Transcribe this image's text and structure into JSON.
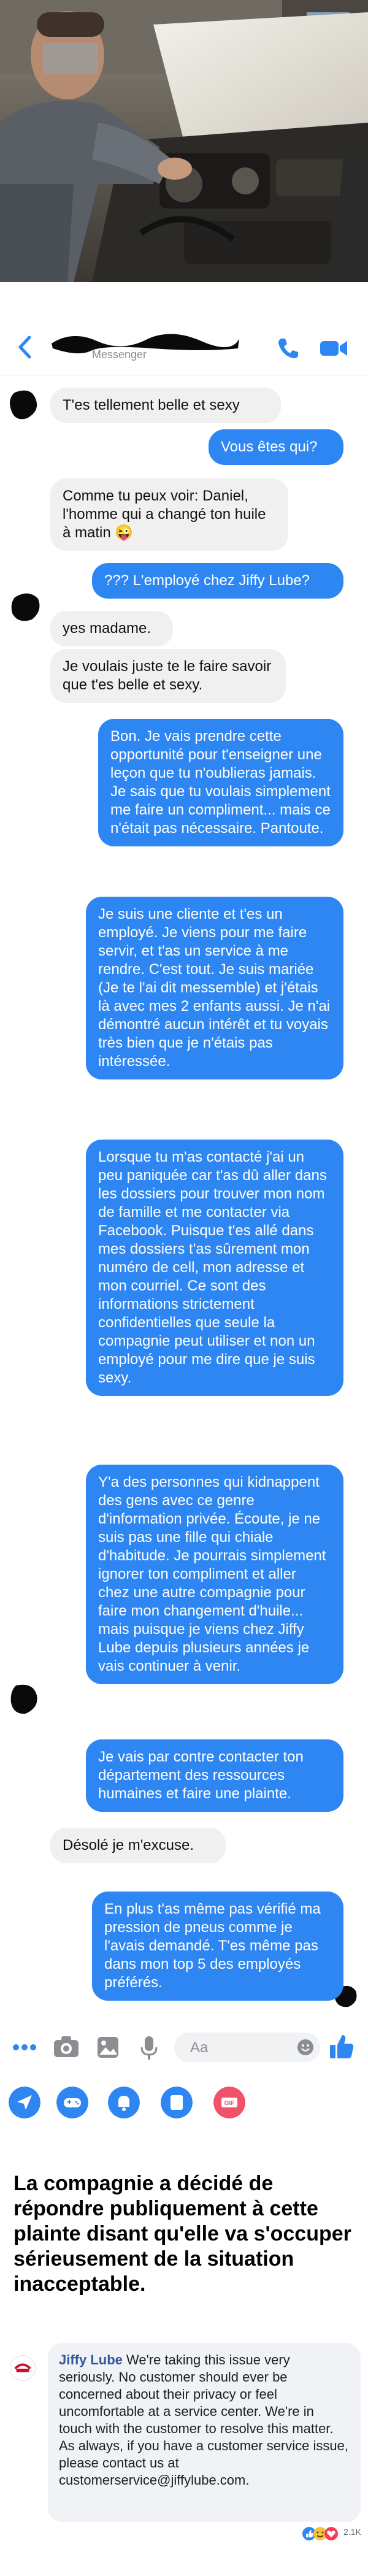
{
  "header": {
    "subtitle": "Messenger"
  },
  "messages": [
    {
      "from": "in",
      "text": "T'es tellement belle et sexy"
    },
    {
      "from": "out",
      "text": "Vous êtes qui?"
    },
    {
      "from": "in",
      "text": "Comme tu peux voir: Daniel, l'homme qui a changé ton huile à matin 😜"
    },
    {
      "from": "out",
      "text": "??? L'employé chez Jiffy Lube?"
    },
    {
      "from": "in",
      "text": "yes madame."
    },
    {
      "from": "in",
      "text": "Je voulais juste te le faire savoir que t'es belle et sexy."
    },
    {
      "from": "out",
      "text": "Bon. Je vais prendre cette opportunité pour t'enseigner une leçon que tu n'oublieras jamais. Je sais que tu voulais simplement me faire un compliment... mais ce n'était pas nécessaire. Pantoute."
    },
    {
      "from": "out",
      "text": "Je suis une cliente et t'es un employé. Je viens pour me faire servir, et t'as un service à me rendre. C'est tout. Je suis mariée (Je te l'ai dit messemble) et j'étais là avec mes 2 enfants aussi. Je n'ai démontré aucun intérêt et tu voyais très bien que je n'étais pas intéressée."
    },
    {
      "from": "out",
      "text": "Lorsque tu m'as contacté j'ai un peu paniquée car t'as dû aller dans les dossiers pour trouver mon nom de famille et me contacter via Facebook. Puisque t'es allé dans mes dossiers t'as sûrement mon numéro de cell, mon adresse et mon courriel. Ce sont des informations strictement confidentielles que seule la compagnie peut utiliser et non un employé pour me dire que je suis sexy."
    },
    {
      "from": "out",
      "text": "Y'a des personnes qui kidnappent des gens avec ce genre d'information privée. Écoute, je ne suis pas une fille qui chiale d'habitude. Je pourrais simplement ignorer ton compliment et aller chez une autre compagnie pour faire mon changement d'huile... mais puisque je viens chez Jiffy Lube depuis plusieurs années je vais continuer à venir."
    },
    {
      "from": "out",
      "text": "Je vais par contre contacter ton département des ressources humaines et faire une plainte."
    },
    {
      "from": "in",
      "text": "Désolé je m'excuse."
    },
    {
      "from": "out",
      "text": "En plus t'as même pas vérifié ma pression de pneus comme je l'avais demandé. T'es même pas dans mon top 5 des employés préférés."
    }
  ],
  "composer": {
    "placeholder": "Aa"
  },
  "caption": "La compagnie a décidé de répondre publiquement à cette plainte disant qu'elle va s'occuper sérieusement de la situation inacceptable.",
  "comment": {
    "author": "Jiffy Lube",
    "text": "We're taking this issue very seriously. No customer should ever be concerned about their privacy or feel uncomfortable at a service center. We're in touch with the customer to resolve this matter. As always, if you have a customer service issue, please contact us at customerservice@jiffylube.com.",
    "reaction_count": "2.1K"
  },
  "colors": {
    "messenger_blue": "#2d86f2",
    "incoming_bubble": "#f1f0f0",
    "icon_blue": "#2d86f2",
    "fb_link": "#365899"
  }
}
